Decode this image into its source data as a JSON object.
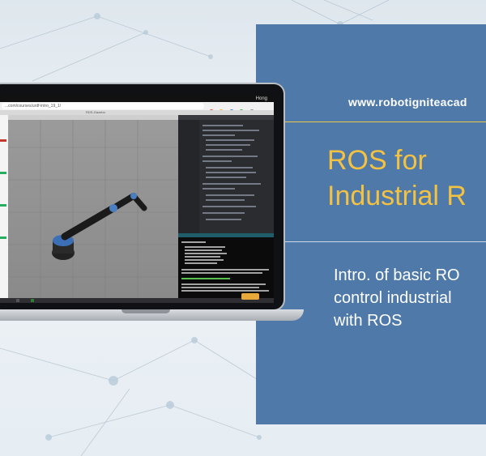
{
  "brand": {
    "url": "www.robotigniteacad"
  },
  "course": {
    "title_line1": "ROS for",
    "title_line2": "Industrial R",
    "subtitle_line1": "Intro. of basic RO",
    "subtitle_line2": "control industrial",
    "subtitle_line3": "with ROS"
  },
  "screen": {
    "user_label": "Hong",
    "address": "...com/courses/urdf-intro_19_1/",
    "panel_tag": "RDS-Gazebo",
    "term_section": "Manipulation:",
    "term_status": "You can start planning now!"
  },
  "colors": {
    "panel": "#4f79a9",
    "title": "#f3c242",
    "url_rule": "#f2c64a",
    "accent_button": "#e8a93a"
  }
}
